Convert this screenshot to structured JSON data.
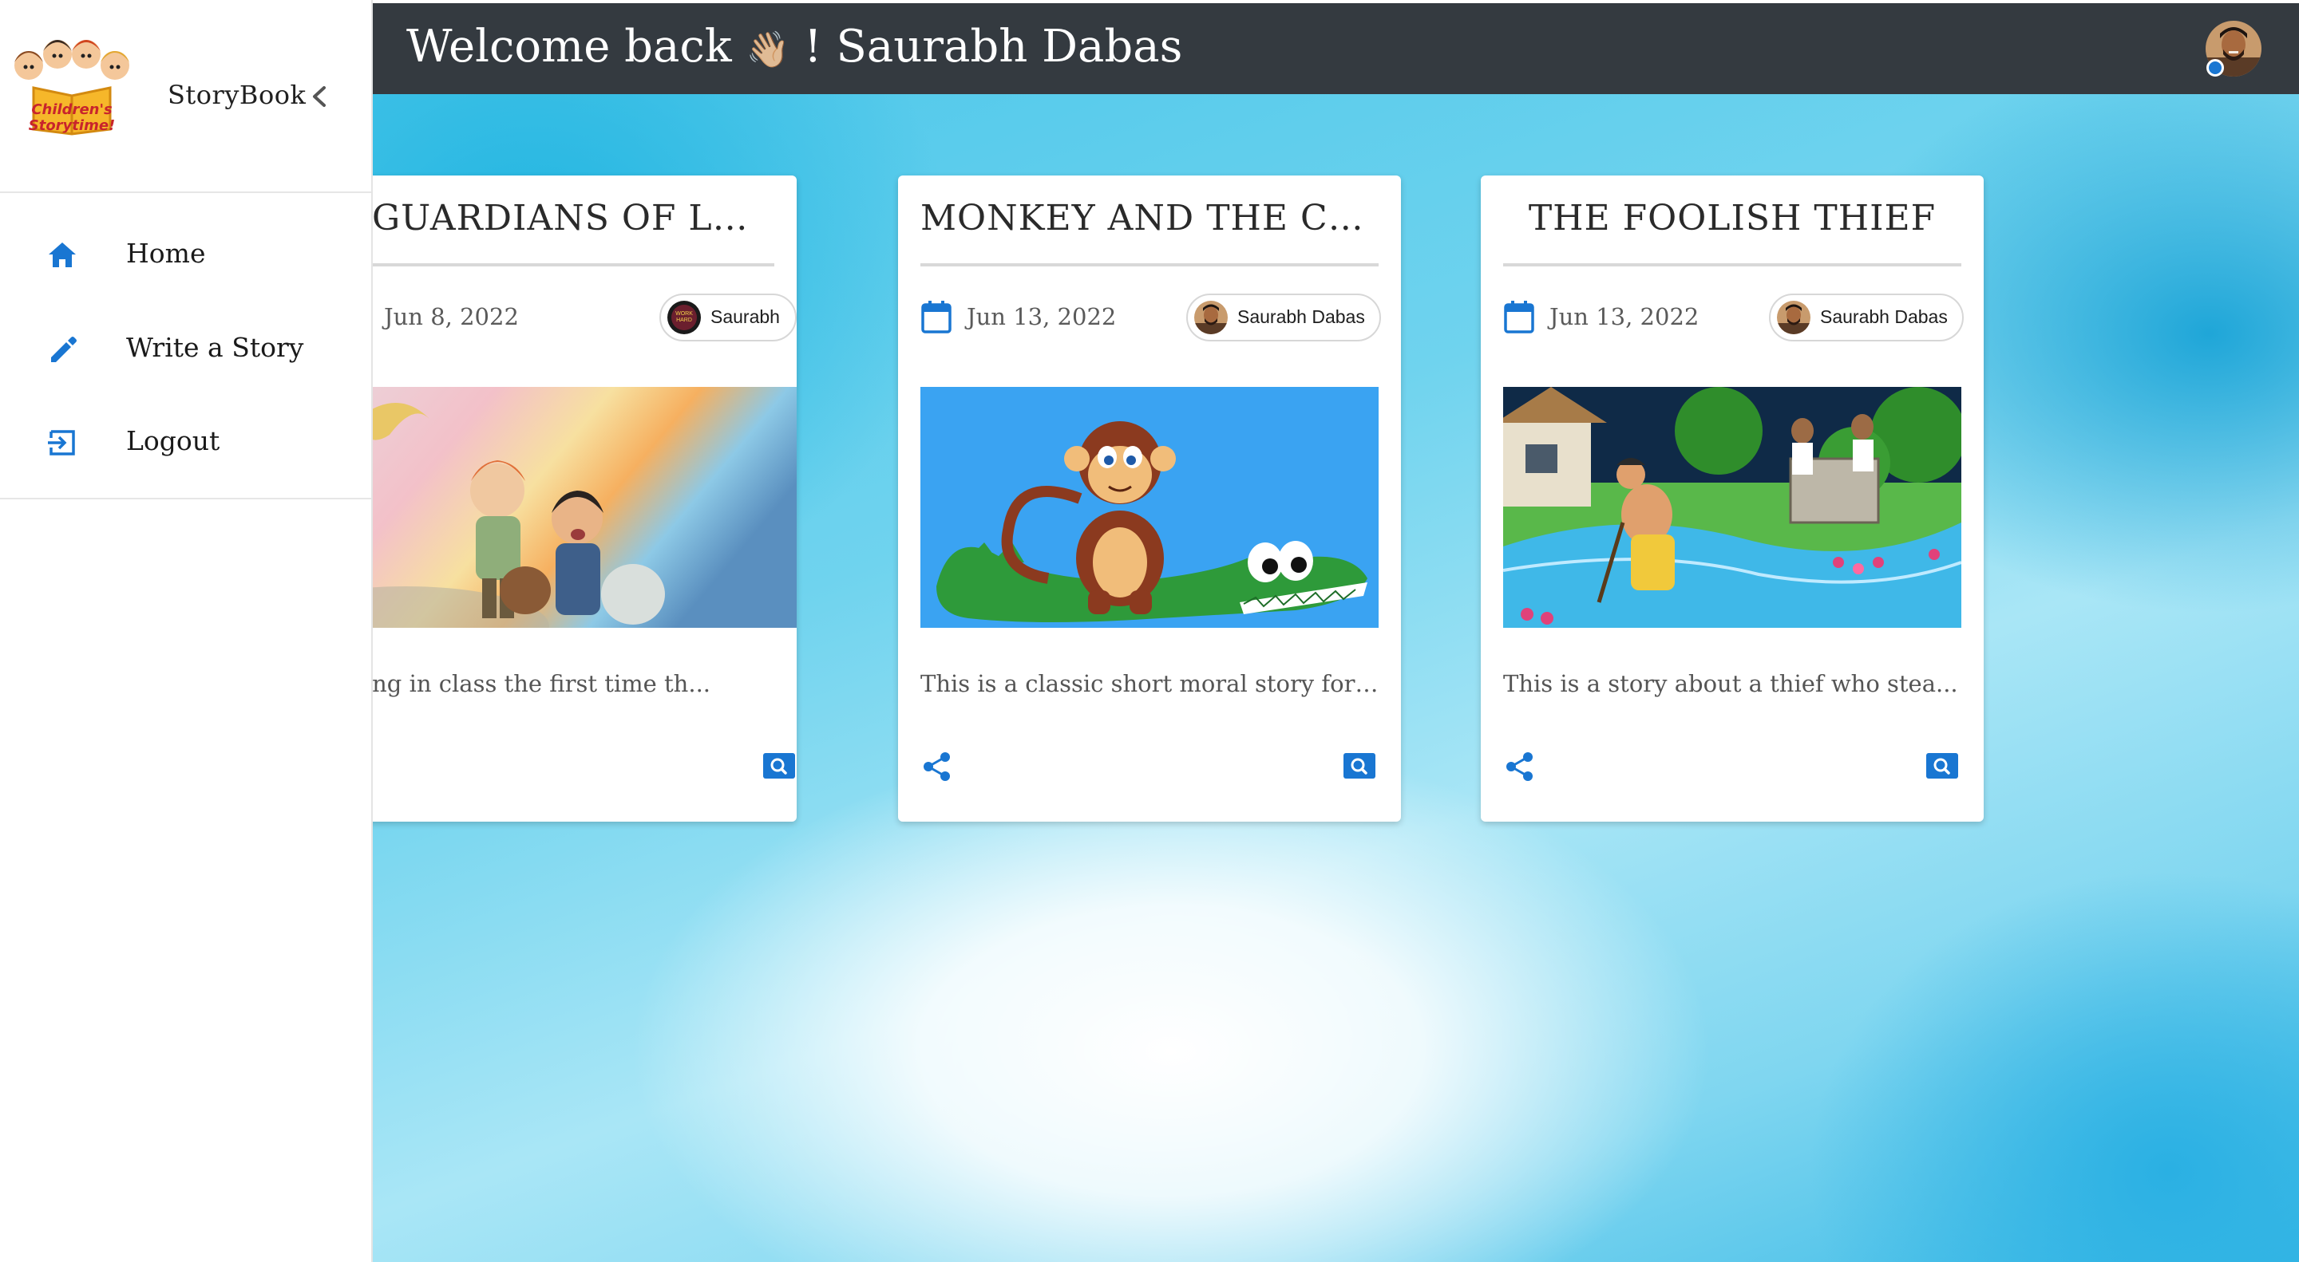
{
  "sidebar": {
    "logo_alt": "Children's Storytime!",
    "logo_text_line1": "Children's",
    "logo_text_line2": "Storytime!",
    "brand_name": "StoryBook",
    "collapse_icon": "chevron-left-icon",
    "items": [
      {
        "label": "Home",
        "icon": "home-icon"
      },
      {
        "label": "Write a Story",
        "icon": "pencil-icon"
      },
      {
        "label": "Logout",
        "icon": "logout-icon"
      }
    ]
  },
  "header": {
    "welcome_prefix": "Welcome back",
    "wave_emoji": "👋🏼",
    "welcome_sep": "!",
    "user_name": "Saurabh Dabas",
    "status_color": "#1976d2"
  },
  "colors": {
    "topbar": "#343a40",
    "accent": "#1976d2",
    "card_bg": "#ffffff"
  },
  "stories": [
    {
      "title": "GUARDIANS OF LORE",
      "date": "Jun 8, 2022",
      "author": "Saurabh",
      "excerpt": "as sitting in class the first time th...",
      "has_share": false
    },
    {
      "title": "MONKEY AND THE CRO...",
      "date": "Jun 13, 2022",
      "author": "Saurabh Dabas",
      "excerpt": "This is a classic short moral story for ...",
      "has_share": true
    },
    {
      "title": "THE FOOLISH THIEF",
      "date": "Jun 13, 2022",
      "author": "Saurabh Dabas",
      "excerpt": "This is a story about a thief who stea...",
      "has_share": true
    }
  ]
}
